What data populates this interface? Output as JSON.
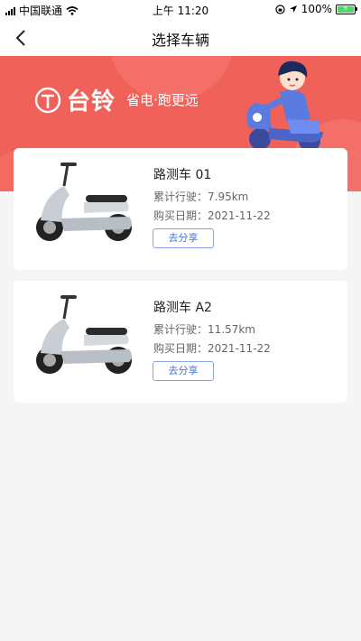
{
  "status_bar": {
    "carrier": "中国联通",
    "time": "上午 11:20",
    "battery": "100%"
  },
  "nav": {
    "title": "选择车辆"
  },
  "banner": {
    "brand": "台铃",
    "slogan": "省电·跑更远"
  },
  "vehicles": [
    {
      "name": "路测车 01",
      "mileage": "累计行驶：7.95km",
      "purchase_date": "购买日期：2021-11-22",
      "share_label": "去分享"
    },
    {
      "name": "路测车 A2",
      "mileage": "累计行驶：11.57km",
      "purchase_date": "购买日期：2021-11-22",
      "share_label": "去分享"
    }
  ],
  "colors": {
    "banner_red": "#f0615a",
    "share_blue": "#4a73d6"
  }
}
